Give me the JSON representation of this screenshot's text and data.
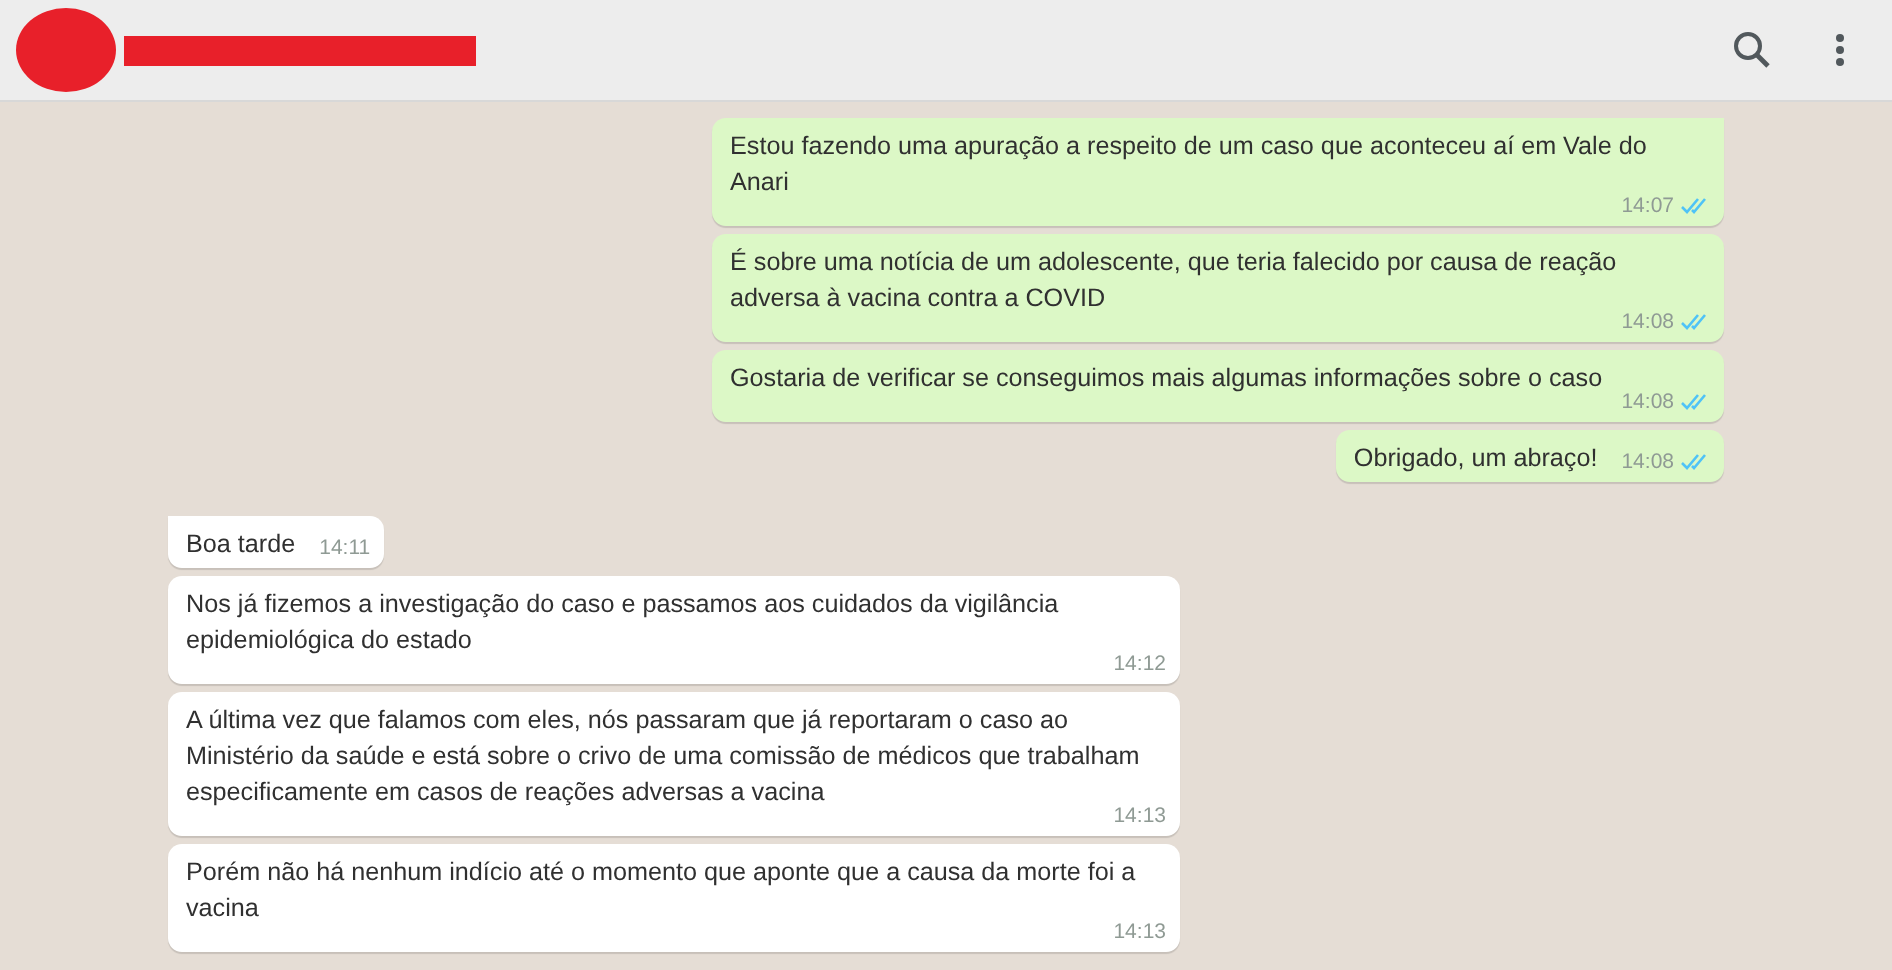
{
  "messages": [
    {
      "kind": "sent",
      "text": "Estou fazendo uma apuração a respeito de um caso que aconteceu aí em Vale do Anari",
      "time": "14:07",
      "read": true
    },
    {
      "kind": "sent",
      "text": "É sobre uma notícia de um adolescente, que teria falecido por causa de reação adversa à vacina contra a COVID",
      "time": "14:08",
      "read": true
    },
    {
      "kind": "sent",
      "text": "Gostaria de verificar se conseguimos mais algumas informações sobre o caso",
      "time": "14:08",
      "read": true
    },
    {
      "kind": "sent",
      "text": "Obrigado, um abraço!",
      "time": "14:08",
      "read": true
    },
    {
      "kind": "received",
      "text": "Boa tarde",
      "time": "14:11"
    },
    {
      "kind": "received",
      "text": "Nos já fizemos a investigação do caso e passamos aos cuidados da vigilância epidemiológica do estado",
      "time": "14:12"
    },
    {
      "kind": "received",
      "text": "A última vez que falamos com eles, nós passaram que já reportaram o caso ao Ministério da saúde e está sobre o crivo de uma comissão de médicos que trabalham especificamente em casos de reações adversas a vacina",
      "time": "14:13"
    },
    {
      "kind": "received",
      "text": "Porém não há nenhum indício até o momento que aponte que a causa da morte foi a vacina",
      "time": "14:13"
    }
  ]
}
